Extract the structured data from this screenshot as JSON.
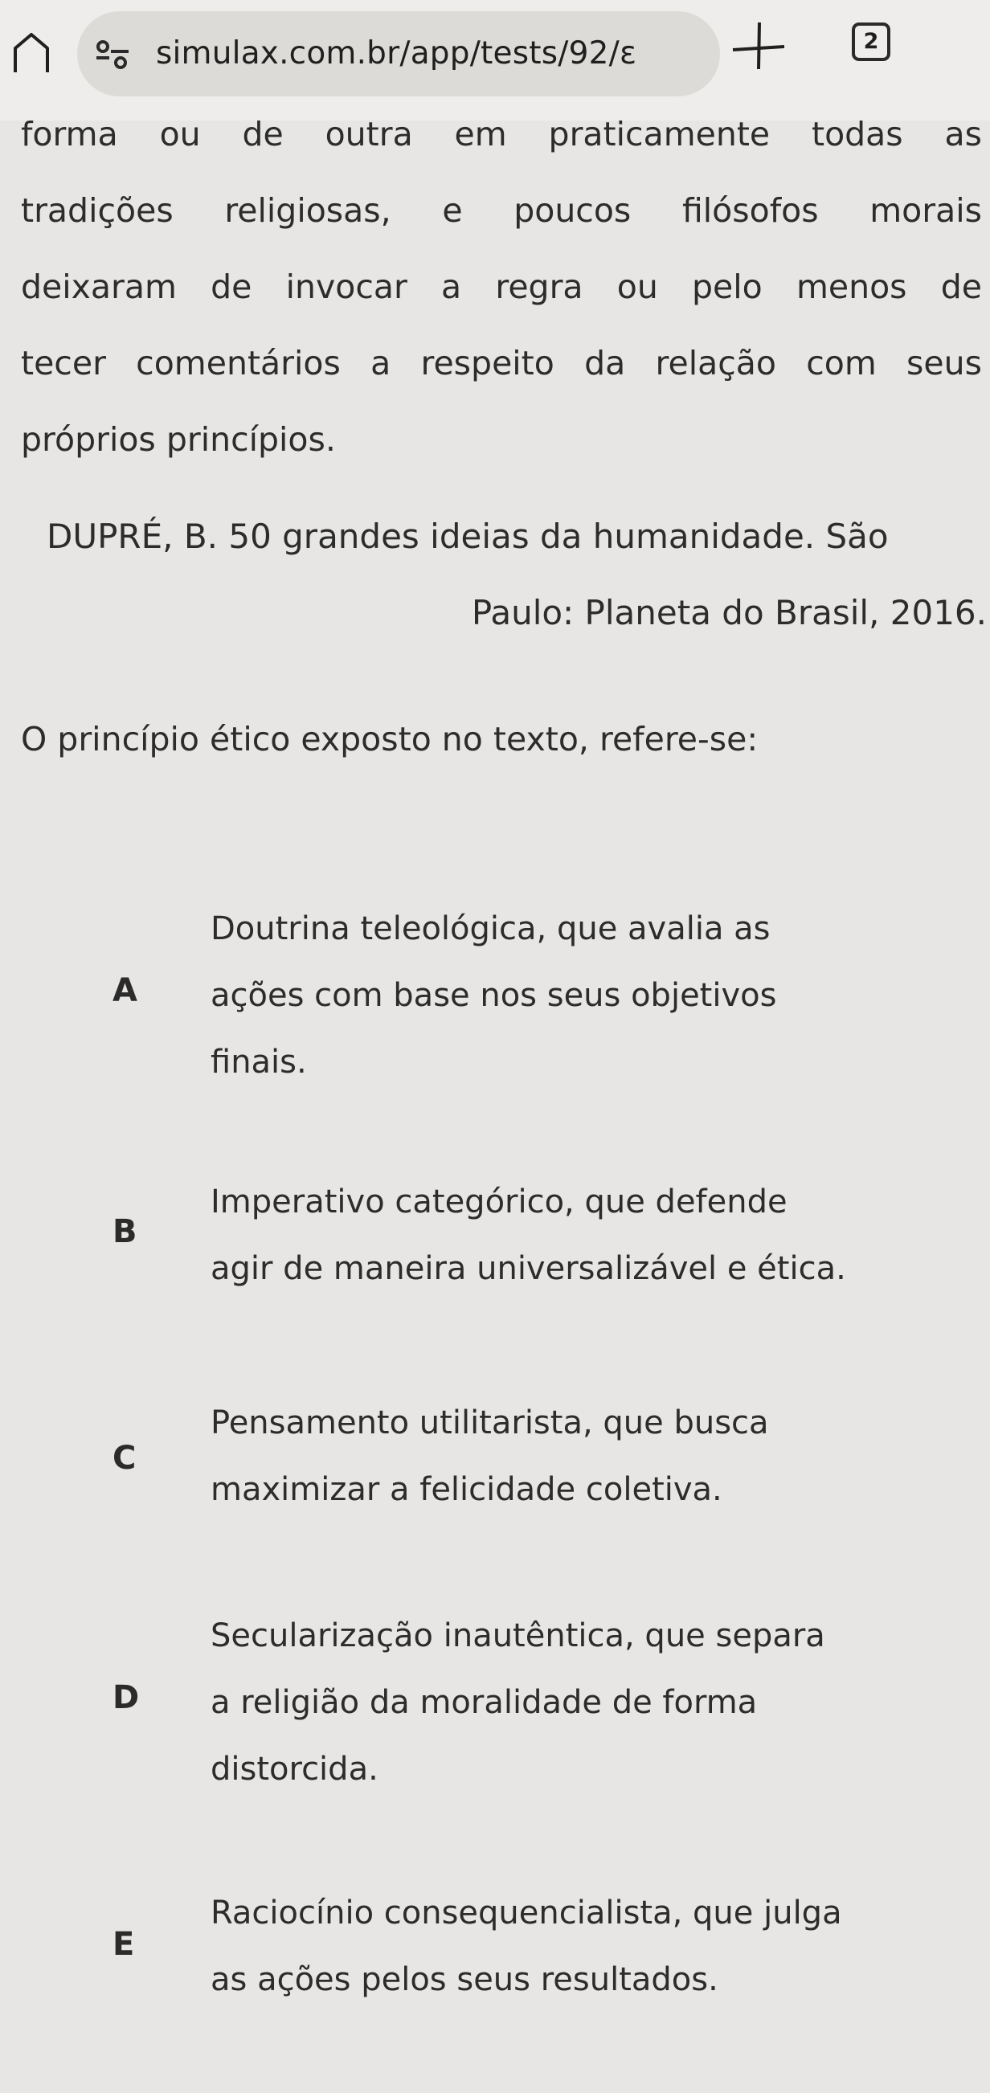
{
  "browser": {
    "url": "simulax.com.br/app/tests/92/ε",
    "tab_count": "2",
    "icons": {
      "home": "home-icon",
      "site_info": "site-info-icon",
      "new_tab": "plus-icon"
    }
  },
  "passage": {
    "lines": [
      "forma ou de outra em praticamente todas as",
      "tradições religiosas, e poucos filósofos morais",
      "deixaram de invocar a regra ou pelo menos de",
      "tecer comentários a respeito da relação com seus",
      "próprios princípios."
    ]
  },
  "citation": {
    "line1": "DUPRÉ, B. 50 grandes ideias da humanidade. São",
    "line2": "Paulo: Planeta do Brasil, 2016."
  },
  "question": "O princípio ético exposto no texto, refere-se:",
  "options": [
    {
      "letter": "A",
      "lines": [
        "Doutrina teleológica, que avalia as",
        "ações com base nos seus objetivos",
        "finais."
      ]
    },
    {
      "letter": "B",
      "lines": [
        "Imperativo categórico, que defende",
        "agir de maneira universalizável e ética."
      ]
    },
    {
      "letter": "C",
      "lines": [
        "Pensamento utilitarista, que busca",
        "maximizar a felicidade coletiva."
      ]
    },
    {
      "letter": "D",
      "lines": [
        "Secularização inautêntica, que separa",
        "a religião da moralidade de forma",
        "distorcida."
      ]
    },
    {
      "letter": "E",
      "lines": [
        "Raciocínio consequencialista, que julga",
        "as ações pelos seus resultados."
      ]
    }
  ]
}
